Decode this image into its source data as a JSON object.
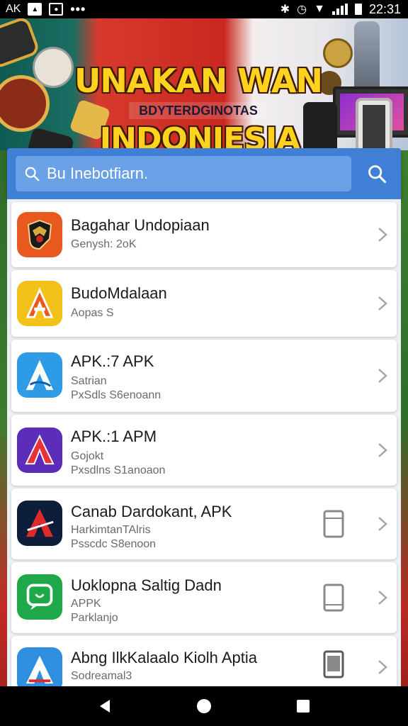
{
  "status_bar": {
    "carrier": "AK",
    "time": "22:31",
    "icons": [
      "image-icon",
      "camera-icon",
      "more-dots-icon",
      "bluetooth-icon",
      "alarm-icon",
      "wifi-icon",
      "signal-icon",
      "battery-icon"
    ]
  },
  "banner": {
    "title": "UNAKAN WAN",
    "subtitle": "BDYTERDGINOTAS",
    "country": "INDONIESIA"
  },
  "search": {
    "placeholder": "Bu Inebotfiarn.",
    "button_icon": "search-icon"
  },
  "apps": [
    {
      "name": "Bagahar Undopiaan",
      "sub1": "Genysh: 2oK",
      "sub2": "",
      "icon": "garuda-shield-icon",
      "icon_bg": "#e8591f",
      "device": false
    },
    {
      "name": "BudoMdalaan",
      "sub1": "Aopas S",
      "sub2": "",
      "icon": "letter-a-icon",
      "icon_bg": "#f2c21a",
      "device": false
    },
    {
      "name": "APK.:7 APK",
      "sub1": "Satrian",
      "sub2": "PxSdls S6enoann",
      "icon": "letter-a-icon",
      "icon_bg": "#2e9be6",
      "device": false
    },
    {
      "name": "APK.:1 APM",
      "sub1": "Gojokt",
      "sub2": "Pxsdlns S1anoaon",
      "icon": "letter-a-icon",
      "icon_bg": "#5b2db8",
      "device": false
    },
    {
      "name": "Canab Dardokant, APK",
      "sub1": "HarkimtanTAlris",
      "sub2": "Psscdc S8enoon",
      "icon": "letter-a-icon",
      "icon_bg": "#0d1e3a",
      "device": true
    },
    {
      "name": "Uoklopna Saltig Dadn",
      "sub1": "APPK",
      "sub2": "Parklanjo",
      "icon": "chat-bubble-icon",
      "icon_bg": "#1fa84a",
      "device": true
    },
    {
      "name": "Abng IlkKalaalo Kiolh Aptia",
      "sub1": "Sodreamal3",
      "sub2": "",
      "icon": "letter-a-icon",
      "icon_bg": "#2f8ee0",
      "device": true
    }
  ],
  "colors": {
    "header_blue": "#3f7fd6",
    "search_field_blue": "#6aa0e6",
    "banner_yellow": "#ffd21f",
    "banner_red": "#c9271f"
  },
  "nav": {
    "back_icon": "back-triangle-icon",
    "home_icon": "home-circle-icon",
    "recents_icon": "recents-square-icon"
  }
}
